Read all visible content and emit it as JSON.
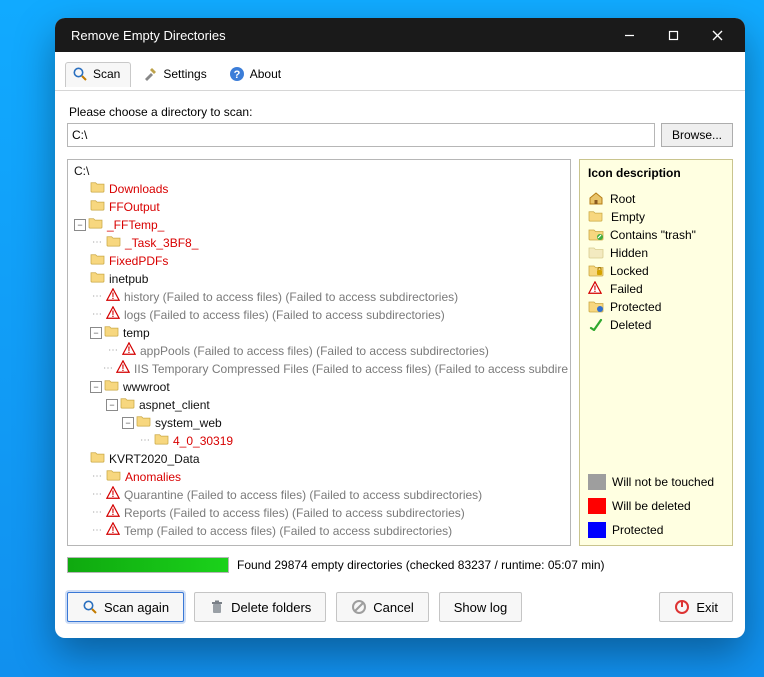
{
  "window": {
    "title": "Remove Empty Directories"
  },
  "tabs": {
    "scan": "Scan",
    "settings": "Settings",
    "about": "About"
  },
  "chooseLabel": "Please choose a directory to scan:",
  "path": "C:\\",
  "browse": "Browse...",
  "tree": {
    "root": "C:\\",
    "nodes": [
      {
        "label": "Downloads",
        "icon": "folder",
        "cls": "t-red"
      },
      {
        "label": "FFOutput",
        "icon": "folder",
        "cls": "t-red"
      },
      {
        "label": "_FFTemp_",
        "icon": "folder",
        "cls": "t-red",
        "expander": "-",
        "kids": [
          {
            "label": "_Task_3BF8_",
            "icon": "folder",
            "cls": "t-red"
          }
        ]
      },
      {
        "label": "FixedPDFs",
        "icon": "folder",
        "cls": "t-red"
      },
      {
        "label": "inetpub",
        "icon": "folder",
        "cls": "t-blk",
        "kids": [
          {
            "label": "history (Failed to access files) (Failed to access subdirectories)",
            "icon": "fail",
            "cls": "t-gray"
          },
          {
            "label": "logs (Failed to access files) (Failed to access subdirectories)",
            "icon": "fail",
            "cls": "t-gray"
          },
          {
            "label": "temp",
            "icon": "folder",
            "cls": "t-blk",
            "expander": "-",
            "kids": [
              {
                "label": "appPools (Failed to access files) (Failed to access subdirectories)",
                "icon": "fail",
                "cls": "t-gray"
              },
              {
                "label": "IIS Temporary Compressed Files (Failed to access files) (Failed to access subdire",
                "icon": "fail",
                "cls": "t-gray"
              }
            ]
          },
          {
            "label": "wwwroot",
            "icon": "folder",
            "cls": "t-blk",
            "expander": "-",
            "kids": [
              {
                "label": "aspnet_client",
                "icon": "folder",
                "cls": "t-blk",
                "expander": "-",
                "kids": [
                  {
                    "label": "system_web",
                    "icon": "folder",
                    "cls": "t-blk",
                    "expander": "-",
                    "kids": [
                      {
                        "label": "4_0_30319",
                        "icon": "folder",
                        "cls": "t-red"
                      }
                    ]
                  }
                ]
              }
            ]
          }
        ]
      },
      {
        "label": "KVRT2020_Data",
        "icon": "folder",
        "cls": "t-blk",
        "kids": [
          {
            "label": "Anomalies",
            "icon": "folder",
            "cls": "t-red"
          },
          {
            "label": "Quarantine (Failed to access files) (Failed to access subdirectories)",
            "icon": "fail",
            "cls": "t-gray"
          },
          {
            "label": "Reports (Failed to access files) (Failed to access subdirectories)",
            "icon": "fail",
            "cls": "t-gray"
          },
          {
            "label": "Temp (Failed to access files) (Failed to access subdirectories)",
            "icon": "fail",
            "cls": "t-gray"
          }
        ]
      }
    ]
  },
  "legend": {
    "title": "Icon description",
    "items": [
      {
        "key": "root",
        "label": "Root"
      },
      {
        "key": "empty",
        "label": "Empty"
      },
      {
        "key": "trash",
        "label": "Contains \"trash\""
      },
      {
        "key": "hidden",
        "label": "Hidden"
      },
      {
        "key": "locked",
        "label": "Locked"
      },
      {
        "key": "failed",
        "label": "Failed"
      },
      {
        "key": "protected",
        "label": "Protected"
      },
      {
        "key": "deleted",
        "label": "Deleted"
      }
    ],
    "swatches": [
      {
        "color": "#9e9e9e",
        "label": "Will not be touched"
      },
      {
        "color": "#ff0000",
        "label": "Will be deleted"
      },
      {
        "color": "#0000ff",
        "label": "Protected"
      }
    ]
  },
  "status": "Found 29874 empty directories (checked 83237 / runtime: 05:07 min)",
  "btns": {
    "scan": "Scan again",
    "delete": "Delete folders",
    "cancel": "Cancel",
    "log": "Show log",
    "exit": "Exit"
  }
}
